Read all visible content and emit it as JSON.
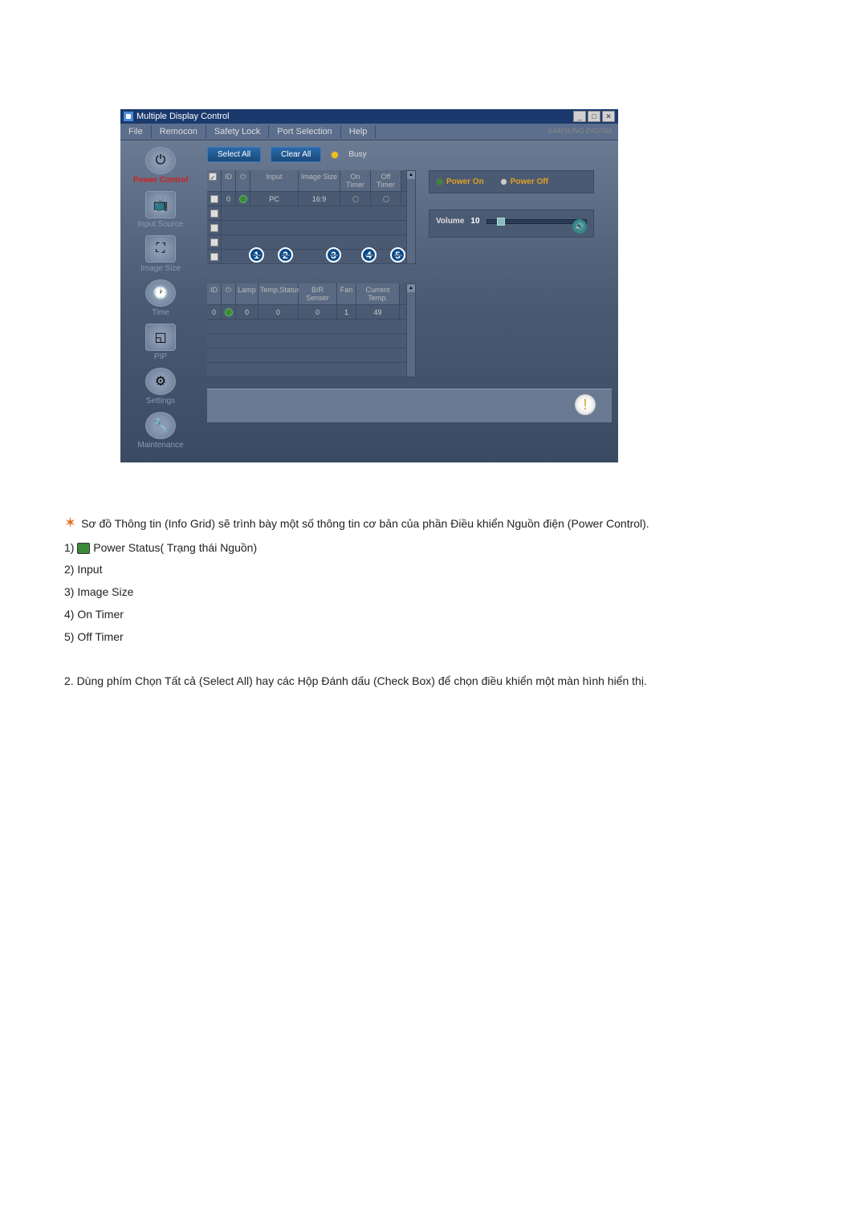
{
  "window": {
    "title": "Multiple Display Control"
  },
  "menu": {
    "file": "File",
    "remocon": "Remocon",
    "safety": "Safety Lock",
    "port": "Port Selection",
    "help": "Help",
    "brand": "SAMSUNG DIGITall"
  },
  "sidebar": {
    "items": [
      {
        "label": "Power Control"
      },
      {
        "label": "Input Source"
      },
      {
        "label": "Image Size"
      },
      {
        "label": "Time"
      },
      {
        "label": "PIP"
      },
      {
        "label": "Settings"
      },
      {
        "label": "Maintenance"
      }
    ]
  },
  "toolbar": {
    "select_all": "Select All",
    "clear_all": "Clear All",
    "busy": "Busy"
  },
  "grid1": {
    "headers": {
      "chk": "",
      "id": "ID",
      "pwr": "",
      "input": "Input",
      "img": "Image Size",
      "ont": "On Timer",
      "offt": "Off Timer"
    },
    "rows": [
      {
        "chk": true,
        "id": "0",
        "pwr": true,
        "input": "PC",
        "img": "16:9",
        "ont": "○",
        "offt": "○"
      }
    ]
  },
  "grid2": {
    "headers": {
      "id": "ID",
      "pwr": "",
      "lamp": "Lamp",
      "temp": "Temp.Status",
      "brs": "B/R Senser",
      "fan": "Fan",
      "ct": "Current Temp."
    },
    "rows": [
      {
        "id": "0",
        "pwr": true,
        "lamp": "0",
        "temp": "0",
        "brs": "0",
        "fan": "1",
        "ct": "49"
      }
    ]
  },
  "callouts": {
    "n1": "1",
    "n2": "2",
    "n3": "3",
    "n4": "4",
    "n5": "5"
  },
  "power": {
    "on": "Power On",
    "off": "Power Off"
  },
  "volume": {
    "label": "Volume",
    "value": "10"
  },
  "doc": {
    "intro": "Sơ đồ Thông tin (Info Grid) sẽ trình bày một số thông tin cơ bản của phần Điều khiển Nguồn điện (Power Control).",
    "l1": "1) ",
    "l1b": " Power Status( Trạng thái Nguồn)",
    "l2": "2) Input",
    "l3": "3) Image Size",
    "l4": "4) On Timer",
    "l5": "5) Off Timer",
    "p2": "2.  Dùng phím Chọn Tất cả (Select All) hay các Hộp Đánh dấu (Check Box) để chọn điều khiển một màn hình hiển thị."
  }
}
